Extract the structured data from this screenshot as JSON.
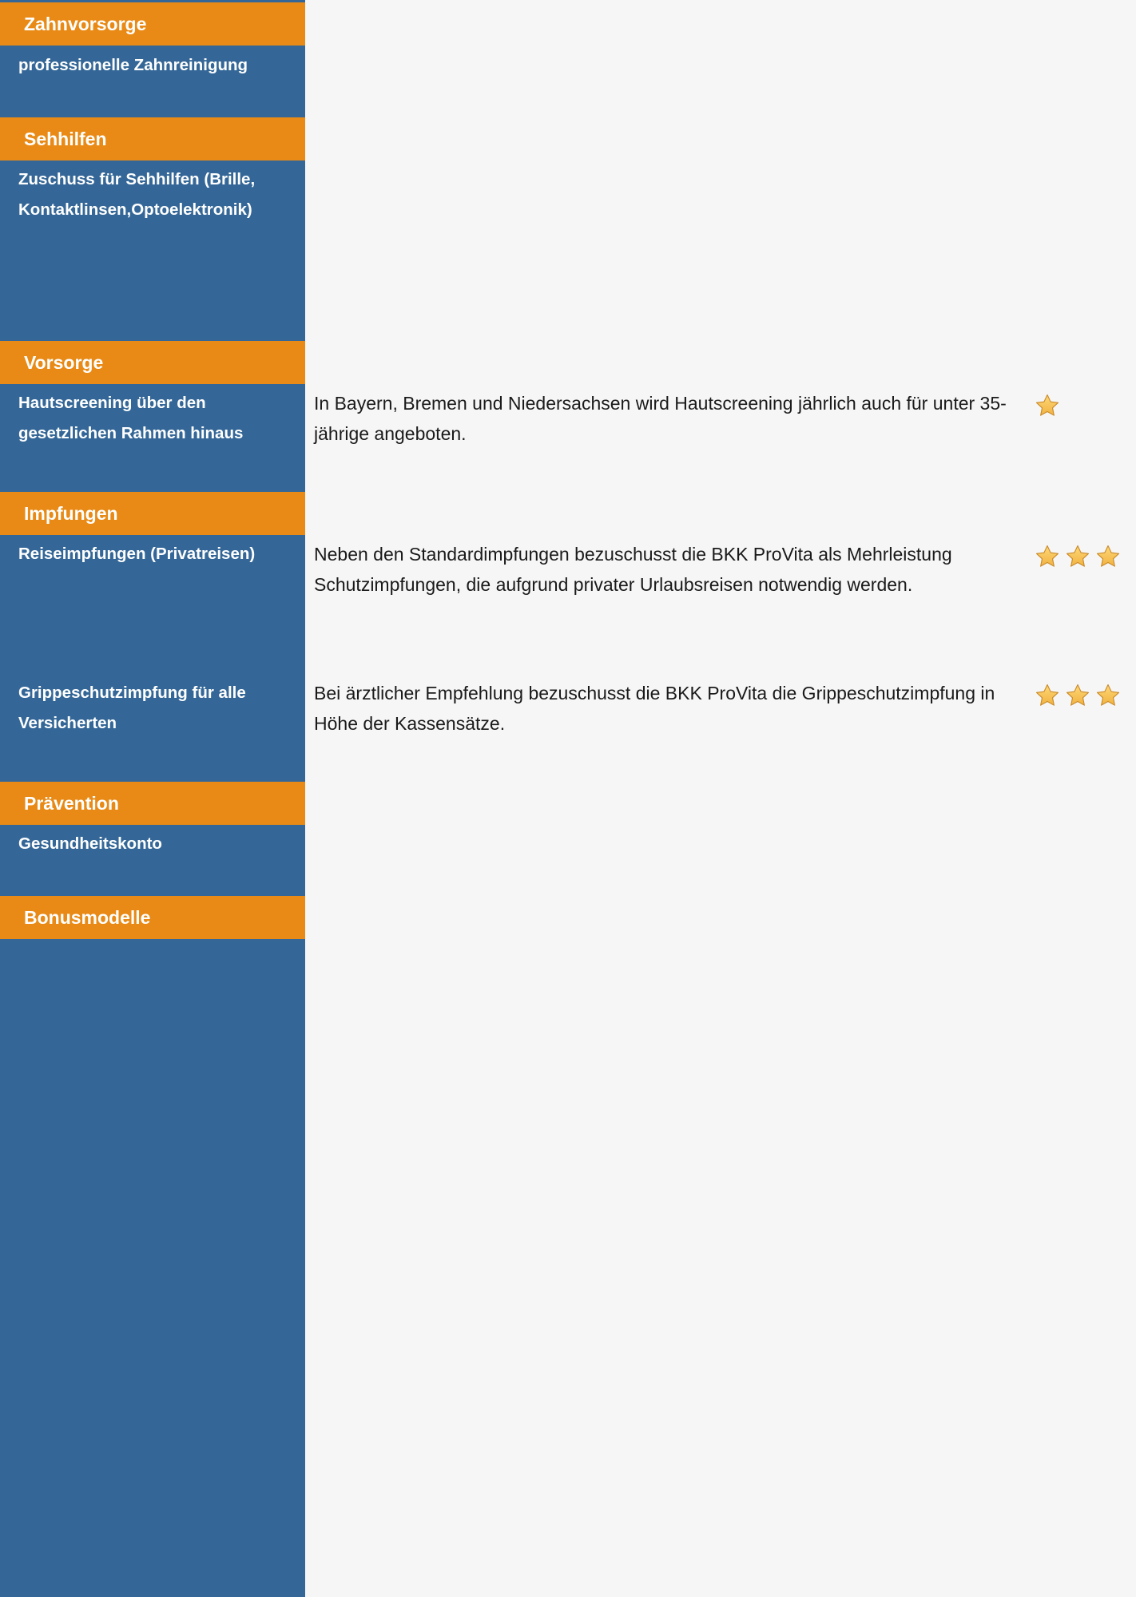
{
  "sections": [
    {
      "category": "Zahnvorsorge",
      "items": [
        {
          "label": "professionelle Zahnreinigung"
        }
      ]
    },
    {
      "category": "Sehhilfen",
      "items": [
        {
          "label": "Zuschuss für Sehhilfen (Brille, Kontaktlinsen,Optoelektronik)"
        }
      ]
    },
    {
      "category": "Vorsorge",
      "items": [
        {
          "label": "Hautscreening über den gesetzlichen Rahmen hinaus",
          "description": "In Bayern, Bremen und Niedersachsen wird Hautscreening jährlich auch für unter 35-jährige angeboten.",
          "stars": 1
        }
      ]
    },
    {
      "category": "Impfungen",
      "items": [
        {
          "label": "Reiseimpfungen (Privatreisen)",
          "description": "Neben den Standardimpfungen bezuschusst die BKK ProVita als Mehrleistung Schutzimpfungen, die aufgrund  privater Urlaubsreisen notwendig werden.",
          "stars": 3
        },
        {
          "label": "Grippeschutzimpfung für alle Versicherten",
          "description": "Bei ärztlicher Empfehlung bezuschusst die BKK ProVita die Grippeschutzimpfung in Höhe der Kassensätze.",
          "stars": 3
        }
      ]
    },
    {
      "category": "Prävention",
      "items": [
        {
          "label": "Gesundheitskonto"
        }
      ]
    },
    {
      "category": "Bonusmodelle",
      "items": []
    }
  ],
  "colors": {
    "sidebar": "#346797",
    "category_header": "#e88a15",
    "star": "#f0b240"
  },
  "icons": {
    "rating": "star-icon"
  }
}
